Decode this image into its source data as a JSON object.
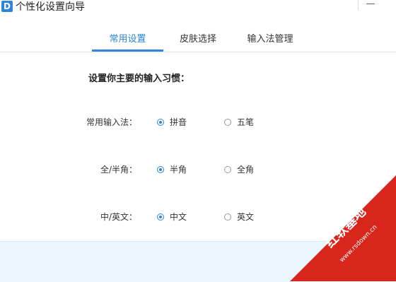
{
  "window": {
    "title": "个性化设置向导",
    "app_icon_letter": "D",
    "close_glyph": "—"
  },
  "tabs": [
    {
      "label": "常用设置",
      "active": true
    },
    {
      "label": "皮肤选择",
      "active": false
    },
    {
      "label": "输入法管理",
      "active": false
    }
  ],
  "settings": {
    "heading": "设置你主要的输入习惯：",
    "rows": [
      {
        "label": "常用输入法：",
        "options": [
          {
            "label": "拼音",
            "checked": true
          },
          {
            "label": "五笔",
            "checked": false
          }
        ]
      },
      {
        "label": "全/半角：",
        "options": [
          {
            "label": "半角",
            "checked": true
          },
          {
            "label": "全角",
            "checked": false
          }
        ]
      },
      {
        "label": "中/英文：",
        "options": [
          {
            "label": "中文",
            "checked": true
          },
          {
            "label": "英文",
            "checked": false
          }
        ]
      }
    ]
  },
  "watermark": {
    "text": "红软基地",
    "url": "www.rsdown.cn"
  },
  "colors": {
    "accent": "#2f86d8",
    "footer_bg": "#eaf6fd",
    "watermark_red": "#d9261c"
  }
}
